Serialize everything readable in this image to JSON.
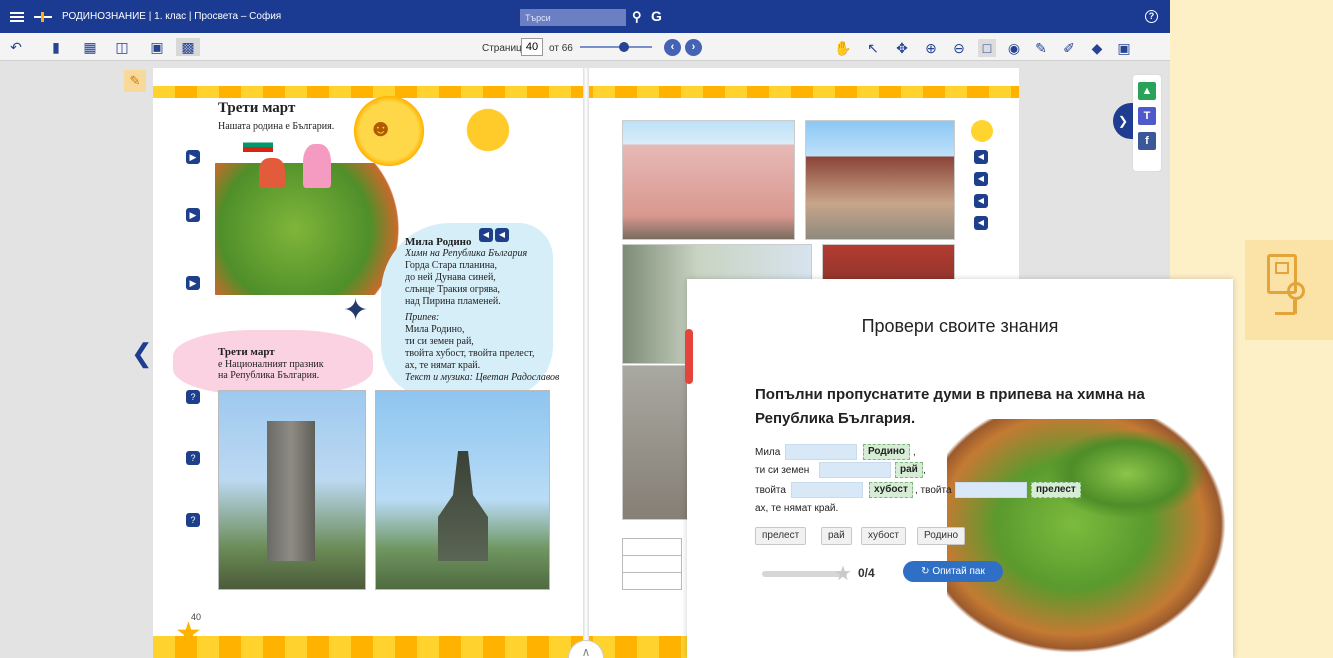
{
  "topbar": {
    "title": "РОДИНОЗНАНИЕ | 1. клас | Просвета – София",
    "search_placeholder": "Търси",
    "search_icon": "search-icon",
    "g_label": "G",
    "help_label": "?"
  },
  "toolbar": {
    "page_label": "Страница",
    "page_value": "40",
    "page_of": "от 66",
    "page_progress": 0.61,
    "prev_label": "‹",
    "next_label": "›"
  },
  "left_page": {
    "heading": "Трети март",
    "subheading": "Нашата родина е България.",
    "anthem_title": "Мила Родино",
    "anthem_subtitle": "Химн на Република България",
    "anthem_verse": [
      "Горда Стара планина,",
      "до ней Дунава синей,",
      "слънце Тракия огрява,",
      "над Пирина пламеней."
    ],
    "refrain_label": "Припев:",
    "refrain": [
      "Мила Родино,",
      "ти си земен рай,",
      "твойта хубост, твойта прелест,",
      "ах, те нямат край."
    ],
    "credits": "Текст и музика: Цветан Радославов",
    "holiday_title": "Трети март",
    "holiday_text": [
      "е Националният празник",
      "на Република България."
    ],
    "page_number": "40"
  },
  "quiz": {
    "title": "Провери своите знания",
    "question": "Попълни пропуснатите думи в припева на химна на Република България.",
    "line1_prefix": "Мила",
    "line1_answer": "Родино",
    "line1_suffix": ",",
    "line2_prefix": "ти си земен",
    "line2_answer": "рай",
    "line2_suffix": ",",
    "line3_prefix": "твойта",
    "line3_answer": "хубост",
    "line3_mid": ", твойта",
    "line3_answer2": "прелест",
    "line4": "ах, те нямат край.",
    "chips": [
      "прелест",
      "рай",
      "хубост",
      "Родино"
    ],
    "score": "0/4",
    "retry_label": "Опитай пак"
  },
  "colors": {
    "topbar": "#1a3b91",
    "accent": "#2f6fc5",
    "stripe": "#ffb300",
    "page_bg": "#fdefc6"
  }
}
